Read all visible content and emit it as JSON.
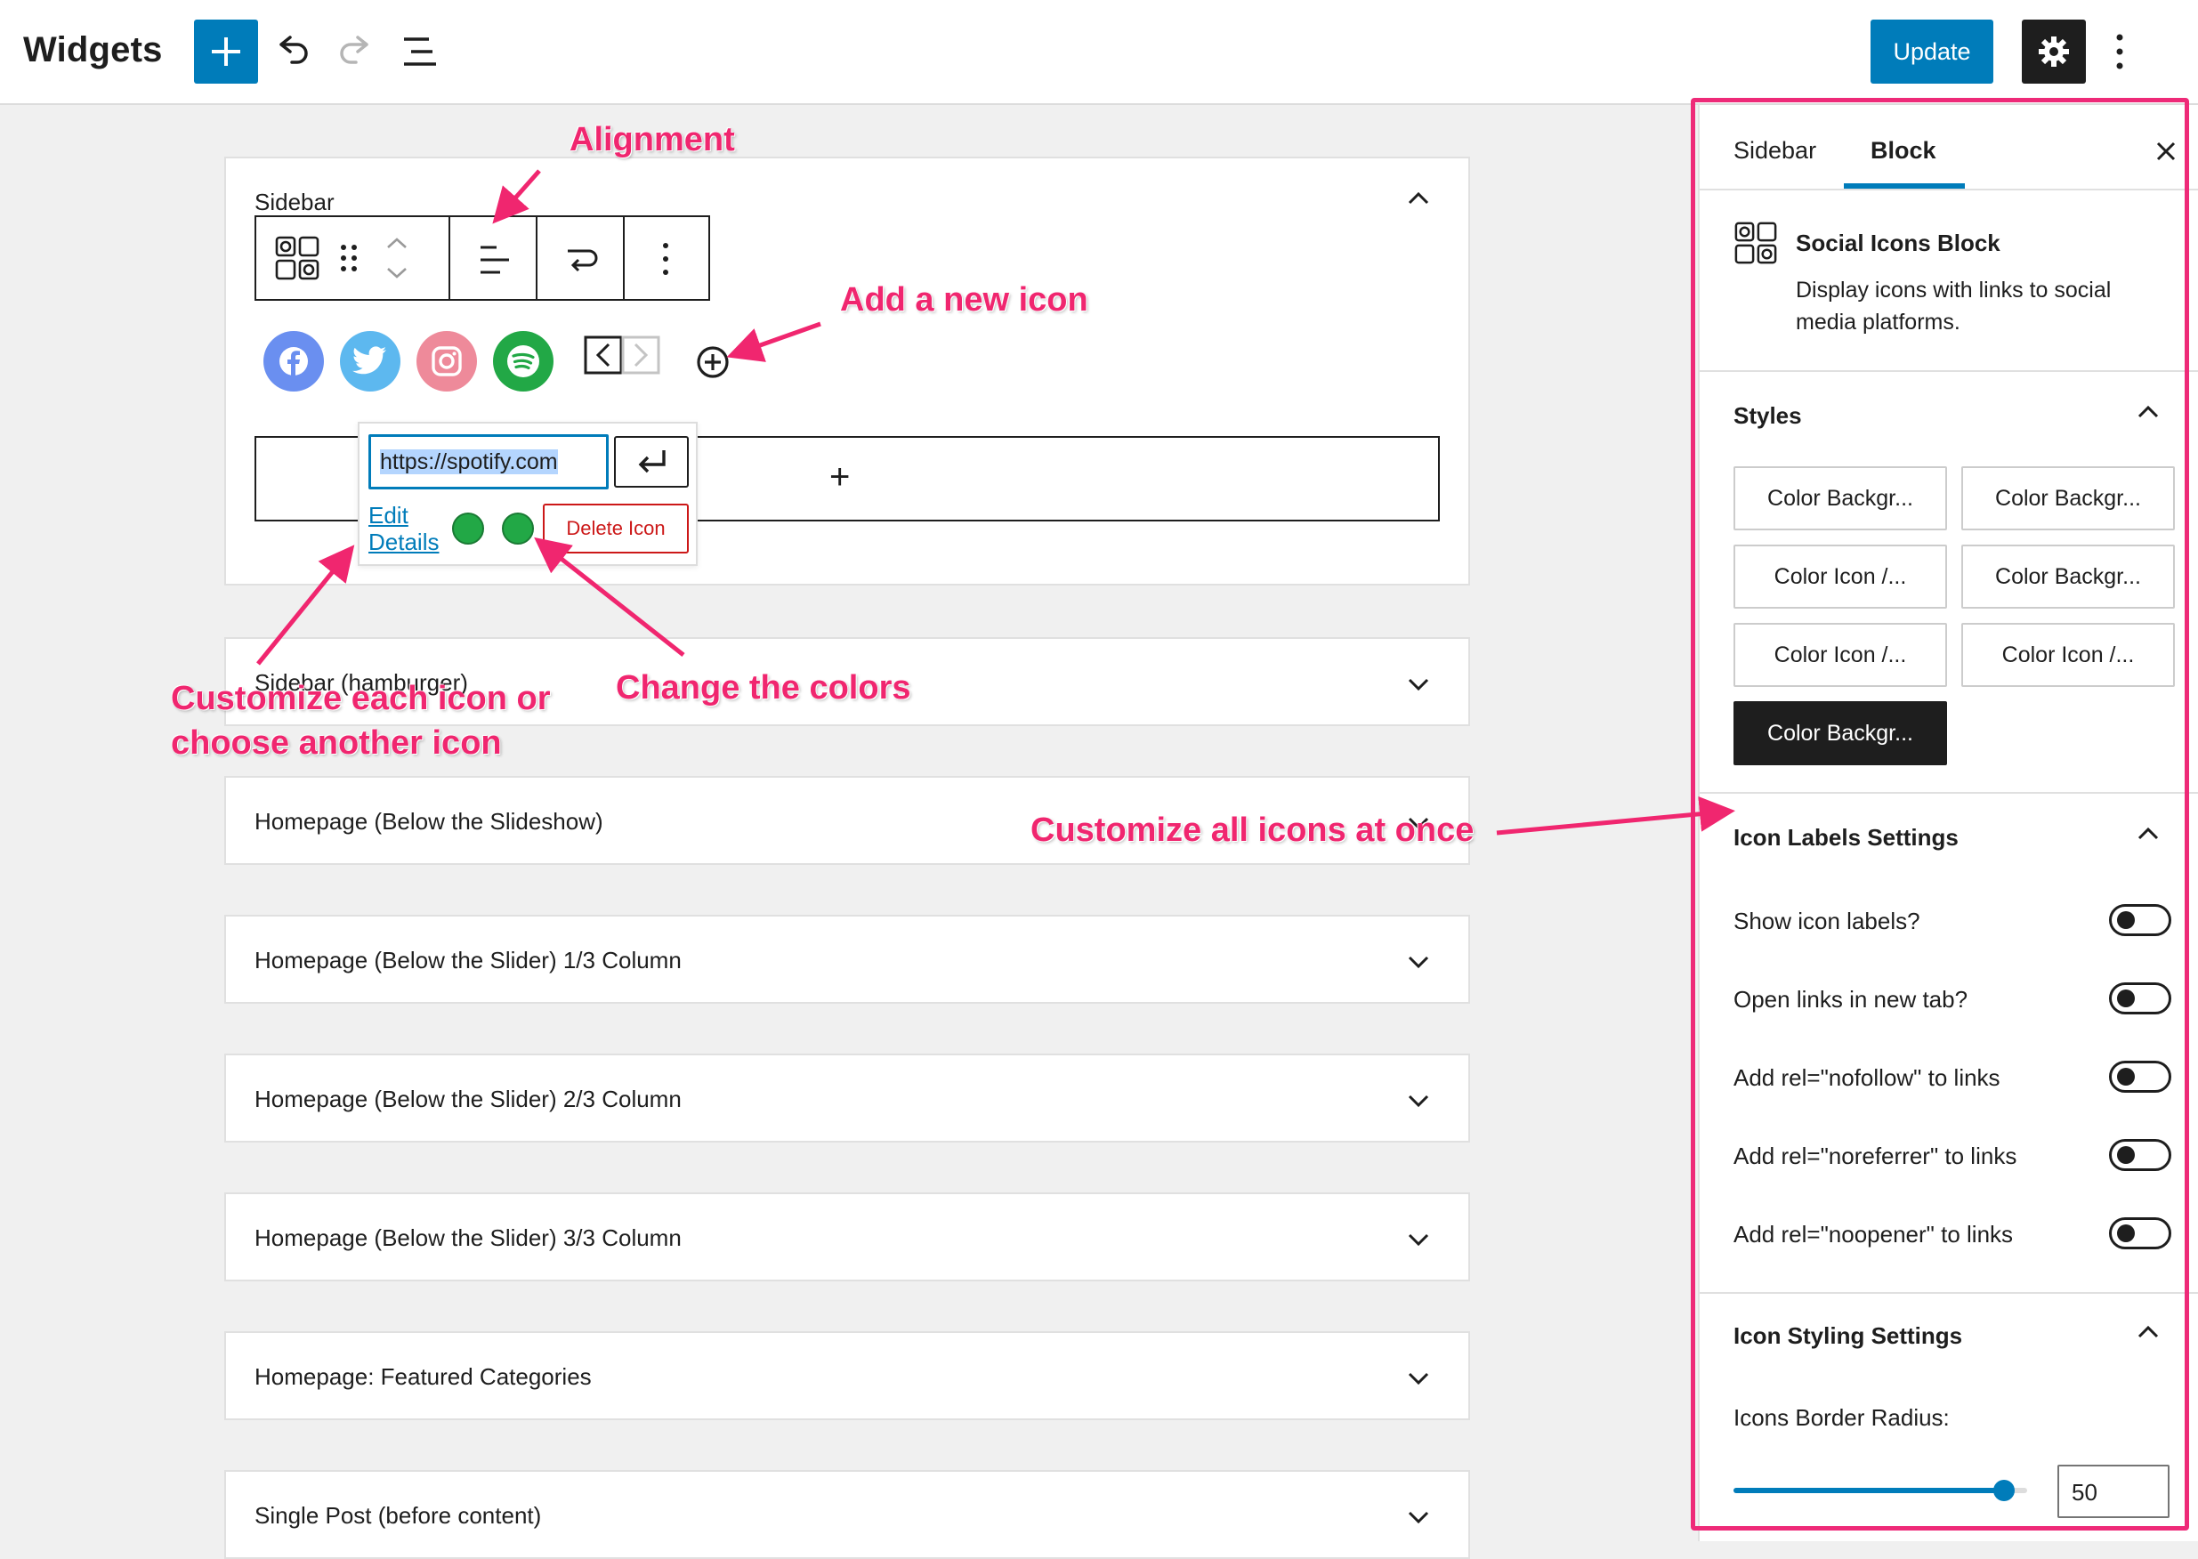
{
  "header": {
    "title": "Widgets",
    "update_label": "Update"
  },
  "editor": {
    "active_area": {
      "title": "Sidebar",
      "url_value": "https://spotify.com",
      "edit_details_line1": "Edit",
      "edit_details_line2": "Details",
      "delete_label": "Delete Icon",
      "appender_symbol": "+"
    },
    "areas": [
      "Sidebar (hamburger)",
      "Homepage (Below the Slideshow)",
      "Homepage (Below the Slider) 1/3 Column",
      "Homepage (Below the Slider) 2/3 Column",
      "Homepage (Below the Slider) 3/3 Column",
      "Homepage: Featured Categories",
      "Single Post (before content)"
    ],
    "social_icons": [
      {
        "name": "facebook",
        "color": "#6a8ff0"
      },
      {
        "name": "twitter",
        "color": "#5db8ef"
      },
      {
        "name": "instagram",
        "color": "#ee8a9a"
      },
      {
        "name": "spotify",
        "color": "#22a846"
      }
    ]
  },
  "sidebar": {
    "tabs": [
      "Sidebar",
      "Block"
    ],
    "active_tab": "Block",
    "block": {
      "name": "Social Icons Block",
      "description_line1": "Display icons with links to social",
      "description_line2": "media platforms."
    },
    "styles": {
      "title": "Styles",
      "options": [
        "Color Backgr...",
        "Color Backgr...",
        "Color Icon /...",
        "Color Backgr...",
        "Color Icon /...",
        "Color Icon /...",
        "Color Backgr..."
      ],
      "active_index": 6
    },
    "icon_labels": {
      "title": "Icon Labels Settings",
      "toggles": [
        "Show icon labels?",
        "Open links in new tab?",
        "Add rel=\"nofollow\" to links",
        "Add rel=\"noreferrer\" to links",
        "Add rel=\"noopener\" to links"
      ]
    },
    "icon_styling": {
      "title": "Icon Styling Settings",
      "border_radius_label": "Icons Border Radius:",
      "border_radius_value": "50",
      "border_radius_fraction": 0.92
    }
  },
  "annotations": {
    "alignment": "Alignment",
    "add_icon": "Add a new icon",
    "customize_each_line1": "Customize each icon or",
    "customize_each_line2": "choose another icon",
    "change_colors": "Change the colors",
    "customize_all": "Customize all icons at once"
  },
  "colors": {
    "accent": "#007cba",
    "annotation": "#f0266f",
    "danger": "#cc1818"
  }
}
